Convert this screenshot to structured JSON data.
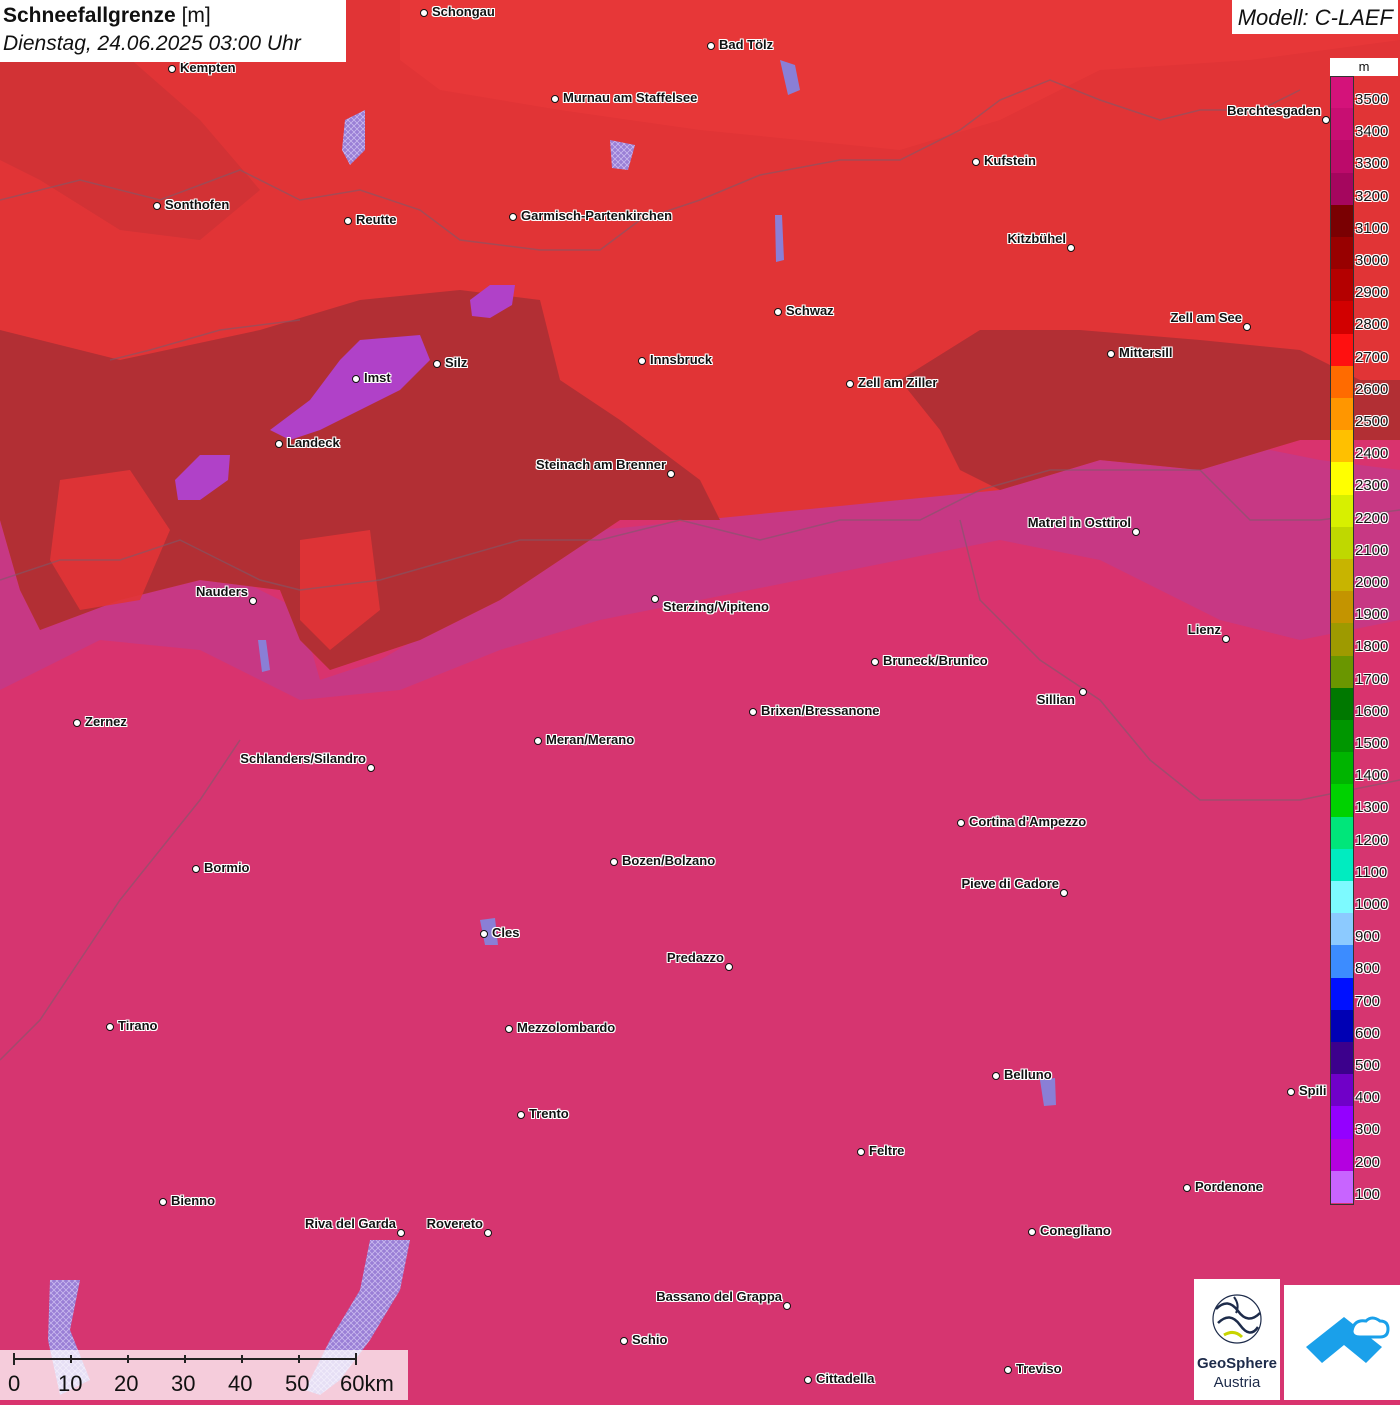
{
  "map": {
    "title": "Schneefallgrenze",
    "unit_bracket": "[m]",
    "subtitle": "Dienstag, 24.06.2025 03:00 Uhr",
    "model": "Modell: C-LAEF",
    "colors": {
      "north_red": "#e13436",
      "north_dark": "#b52e34",
      "south_pink": "#d9336e",
      "transition_purple": "#b23a8e",
      "low_violet": "#b041c8"
    }
  },
  "legend": {
    "unit": "m",
    "bins": [
      {
        "label": "3500",
        "color": "#d4127a"
      },
      {
        "label": "3400",
        "color": "#c80e72"
      },
      {
        "label": "3300",
        "color": "#bc0a6a"
      },
      {
        "label": "3200",
        "color": "#a5065e"
      },
      {
        "label": "3100",
        "color": "#7a0002"
      },
      {
        "label": "3000",
        "color": "#980000"
      },
      {
        "label": "2900",
        "color": "#b40000"
      },
      {
        "label": "2800",
        "color": "#d20000"
      },
      {
        "label": "2700",
        "color": "#ff1010"
      },
      {
        "label": "2600",
        "color": "#ff6b00"
      },
      {
        "label": "2500",
        "color": "#ff9600"
      },
      {
        "label": "2400",
        "color": "#ffc000"
      },
      {
        "label": "2300",
        "color": "#ffff00"
      },
      {
        "label": "2200",
        "color": "#d7f000"
      },
      {
        "label": "2100",
        "color": "#bfd800"
      },
      {
        "label": "2000",
        "color": "#c8b400"
      },
      {
        "label": "1900",
        "color": "#c49400"
      },
      {
        "label": "1800",
        "color": "#9e9a00"
      },
      {
        "label": "1700",
        "color": "#6a9600"
      },
      {
        "label": "1600",
        "color": "#007800"
      },
      {
        "label": "1500",
        "color": "#009600"
      },
      {
        "label": "1400",
        "color": "#00b400"
      },
      {
        "label": "1300",
        "color": "#00d200"
      },
      {
        "label": "1200",
        "color": "#00e67a"
      },
      {
        "label": "1100",
        "color": "#00ecc0"
      },
      {
        "label": "1000",
        "color": "#7dfaff"
      },
      {
        "label": "900",
        "color": "#8ccaff"
      },
      {
        "label": "800",
        "color": "#3c8cff"
      },
      {
        "label": "700",
        "color": "#0010ff"
      },
      {
        "label": "600",
        "color": "#0000b4"
      },
      {
        "label": "500",
        "color": "#3c008c"
      },
      {
        "label": "400",
        "color": "#7000c8"
      },
      {
        "label": "300",
        "color": "#9400ff"
      },
      {
        "label": "200",
        "color": "#b400e0"
      },
      {
        "label": "100",
        "color": "#c864ff"
      }
    ]
  },
  "cities": [
    {
      "name": "Schongau"
    },
    {
      "name": "Bad Tölz"
    },
    {
      "name": "Kempten"
    },
    {
      "name": "Murnau am Staffelsee"
    },
    {
      "name": "Berchtesgaden"
    },
    {
      "name": "Kufstein"
    },
    {
      "name": "Sonthofen"
    },
    {
      "name": "Reutte"
    },
    {
      "name": "Garmisch-Partenkirchen"
    },
    {
      "name": "Kitzbühel"
    },
    {
      "name": "Schwaz"
    },
    {
      "name": "Zell am See"
    },
    {
      "name": "Mittersill"
    },
    {
      "name": "Innsbruck"
    },
    {
      "name": "Silz"
    },
    {
      "name": "Imst"
    },
    {
      "name": "Zell am Ziller"
    },
    {
      "name": "Landeck"
    },
    {
      "name": "Steinach am Brenner"
    },
    {
      "name": "Matrei in Osttirol"
    },
    {
      "name": "Nauders"
    },
    {
      "name": "Sterzing/Vipiteno"
    },
    {
      "name": "Lienz"
    },
    {
      "name": "Bruneck/Brunico"
    },
    {
      "name": "Sillian"
    },
    {
      "name": "Zernez"
    },
    {
      "name": "Brixen/Bressanone"
    },
    {
      "name": "Meran/Merano"
    },
    {
      "name": "Schlanders/Silandro"
    },
    {
      "name": "Cortina d'Ampezzo"
    },
    {
      "name": "Bozen/Bolzano"
    },
    {
      "name": "Bormio"
    },
    {
      "name": "Pieve di Cadore"
    },
    {
      "name": "Cles"
    },
    {
      "name": "Predazzo"
    },
    {
      "name": "Tirano"
    },
    {
      "name": "Mezzolombardo"
    },
    {
      "name": "Belluno"
    },
    {
      "name": "Spili"
    },
    {
      "name": "Trento"
    },
    {
      "name": "Feltre"
    },
    {
      "name": "Pordenone"
    },
    {
      "name": "Bienno"
    },
    {
      "name": "Riva del Garda"
    },
    {
      "name": "Rovereto"
    },
    {
      "name": "Conegliano"
    },
    {
      "name": "Bassano del Grappa"
    },
    {
      "name": "Schio"
    },
    {
      "name": "Treviso"
    },
    {
      "name": "Cittadella"
    }
  ],
  "scalebar": {
    "labels": [
      "0",
      "10",
      "20",
      "30",
      "40",
      "50",
      "60km"
    ]
  },
  "logos": {
    "geosphere_name": "GeoSphere",
    "geosphere_sub": "Austria"
  }
}
